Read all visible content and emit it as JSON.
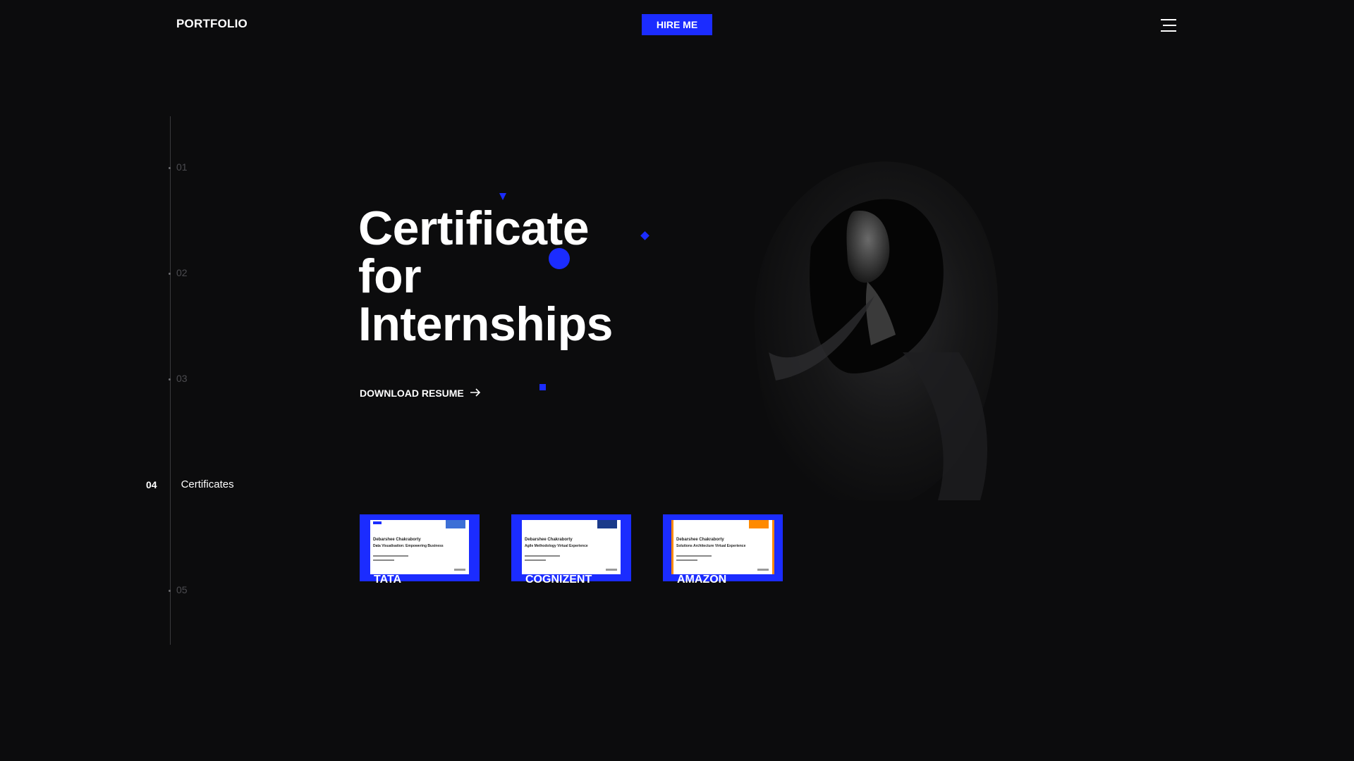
{
  "header": {
    "logo": "PORTFOLIO",
    "hire_label": "HIRE ME",
    "menu_icon": "hamburger-menu-icon"
  },
  "nav": {
    "items": [
      {
        "number": "01",
        "label": ""
      },
      {
        "number": "02",
        "label": ""
      },
      {
        "number": "03",
        "label": ""
      },
      {
        "number": "04",
        "label": "Certificates",
        "active": true
      },
      {
        "number": "05",
        "label": ""
      }
    ]
  },
  "hero": {
    "title_lines": [
      "Certificate",
      "for",
      "Internships"
    ],
    "download_label": "DOWNLOAD RESUME",
    "download_icon": "arrow-right-icon"
  },
  "certificates": [
    {
      "label": "TATA",
      "holder": "Debarshee Chakraborty",
      "course": "Data Visualisation: Empowering Business",
      "accent": "#1b2cff"
    },
    {
      "label": "COGNIZENT",
      "holder": "Debarshee Chakraborty",
      "course": "Agile Methodology Virtual Experience",
      "accent": "#1b2cff"
    },
    {
      "label": "AMAZON",
      "holder": "Debarshee Chakraborty",
      "course": "Solutions Architecture Virtual Experience",
      "accent": "#ff8a00"
    }
  ],
  "colors": {
    "accent": "#1b2cff",
    "background": "#0c0c0d",
    "amazon_accent": "#ff8a00"
  }
}
